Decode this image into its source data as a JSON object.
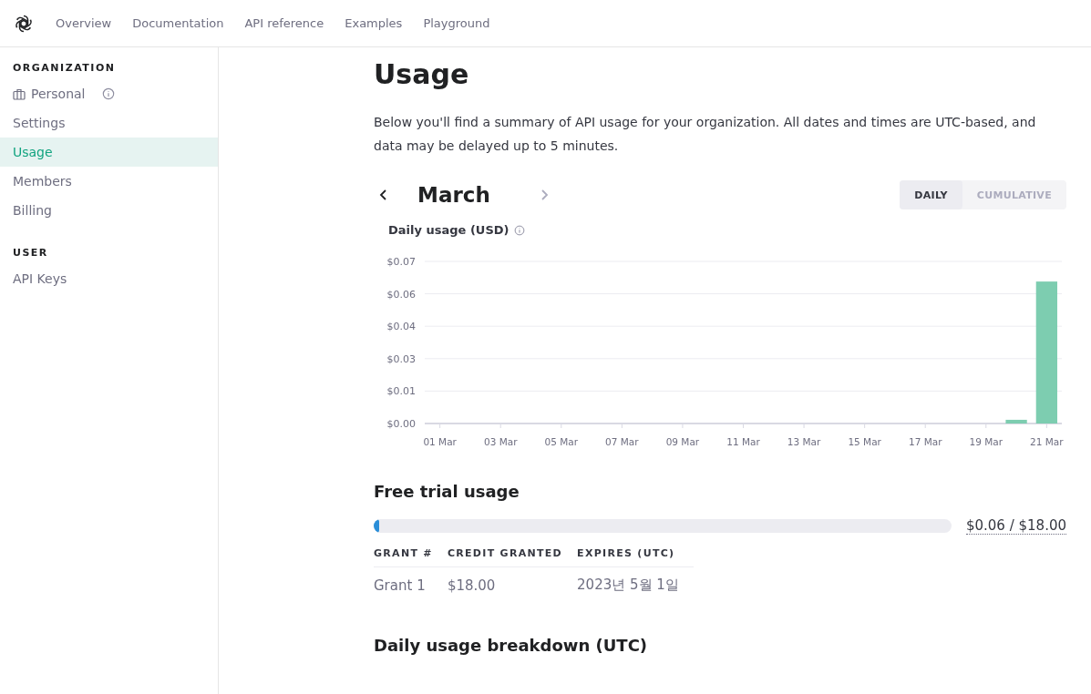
{
  "nav": {
    "items": [
      {
        "label": "Overview",
        "selected": false
      },
      {
        "label": "Documentation",
        "selected": false
      },
      {
        "label": "API reference",
        "selected": false
      },
      {
        "label": "Examples",
        "selected": false
      },
      {
        "label": "Playground",
        "selected": false
      }
    ]
  },
  "sidebar": {
    "sections": [
      {
        "heading": "ORGANIZATION",
        "items": [
          {
            "label": "Personal",
            "kind": "org",
            "selected": false
          },
          {
            "label": "Settings",
            "kind": "link",
            "selected": false
          },
          {
            "label": "Usage",
            "kind": "link",
            "selected": true
          },
          {
            "label": "Members",
            "kind": "link",
            "selected": false
          },
          {
            "label": "Billing",
            "kind": "link",
            "selected": false
          }
        ]
      },
      {
        "heading": "USER",
        "items": [
          {
            "label": "API Keys",
            "kind": "link",
            "selected": false
          }
        ]
      }
    ]
  },
  "page": {
    "title": "Usage",
    "description": "Below you'll find a summary of API usage for your organization. All dates and times are UTC-based, and data may be delayed up to 5 minutes.",
    "month": "March",
    "next_disabled": true,
    "modes": [
      {
        "label": "DAILY",
        "selected": true
      },
      {
        "label": "CUMULATIVE",
        "selected": false
      }
    ],
    "chart": {
      "chart_data": {
        "type": "bar",
        "title": "Daily usage (USD)",
        "grid": true,
        "categories": [
          "01 Mar",
          null,
          "03 Mar",
          null,
          "05 Mar",
          null,
          "07 Mar",
          null,
          "09 Mar",
          null,
          "11 Mar",
          null,
          "13 Mar",
          null,
          "15 Mar",
          null,
          "17 Mar",
          null,
          "19 Mar",
          null,
          "21 Mar"
        ],
        "series": [
          {
            "color": "#7dcdb0",
            "values": [
              0,
              0,
              0,
              0,
              0,
              0,
              0,
              0,
              0,
              0,
              0,
              0,
              0,
              0,
              0,
              0,
              0,
              0,
              0,
              0.0016,
              0.0613
            ]
          }
        ],
        "ylim": [
          0,
          0.07
        ],
        "yticks": [
          {
            "value": 0,
            "label": "$0.00"
          },
          {
            "value": 0.014,
            "label": "$0.01"
          },
          {
            "value": 0.028,
            "label": "$0.03"
          },
          {
            "value": 0.042,
            "label": "$0.04"
          },
          {
            "value": 0.056,
            "label": "$0.06"
          },
          {
            "value": 0.07,
            "label": "$0.07"
          }
        ]
      }
    },
    "trial": {
      "title": "Free trial usage",
      "level": 0.0033,
      "reading": "$0.06 / $18.00",
      "columns": [
        "GRANT #",
        "CREDIT GRANTED",
        "EXPIRES (UTC)"
      ],
      "rows": [
        [
          "Grant 1",
          "$18.00",
          "2023년 5월 1일"
        ]
      ]
    },
    "breakdown_title": "Daily usage breakdown (UTC)"
  }
}
